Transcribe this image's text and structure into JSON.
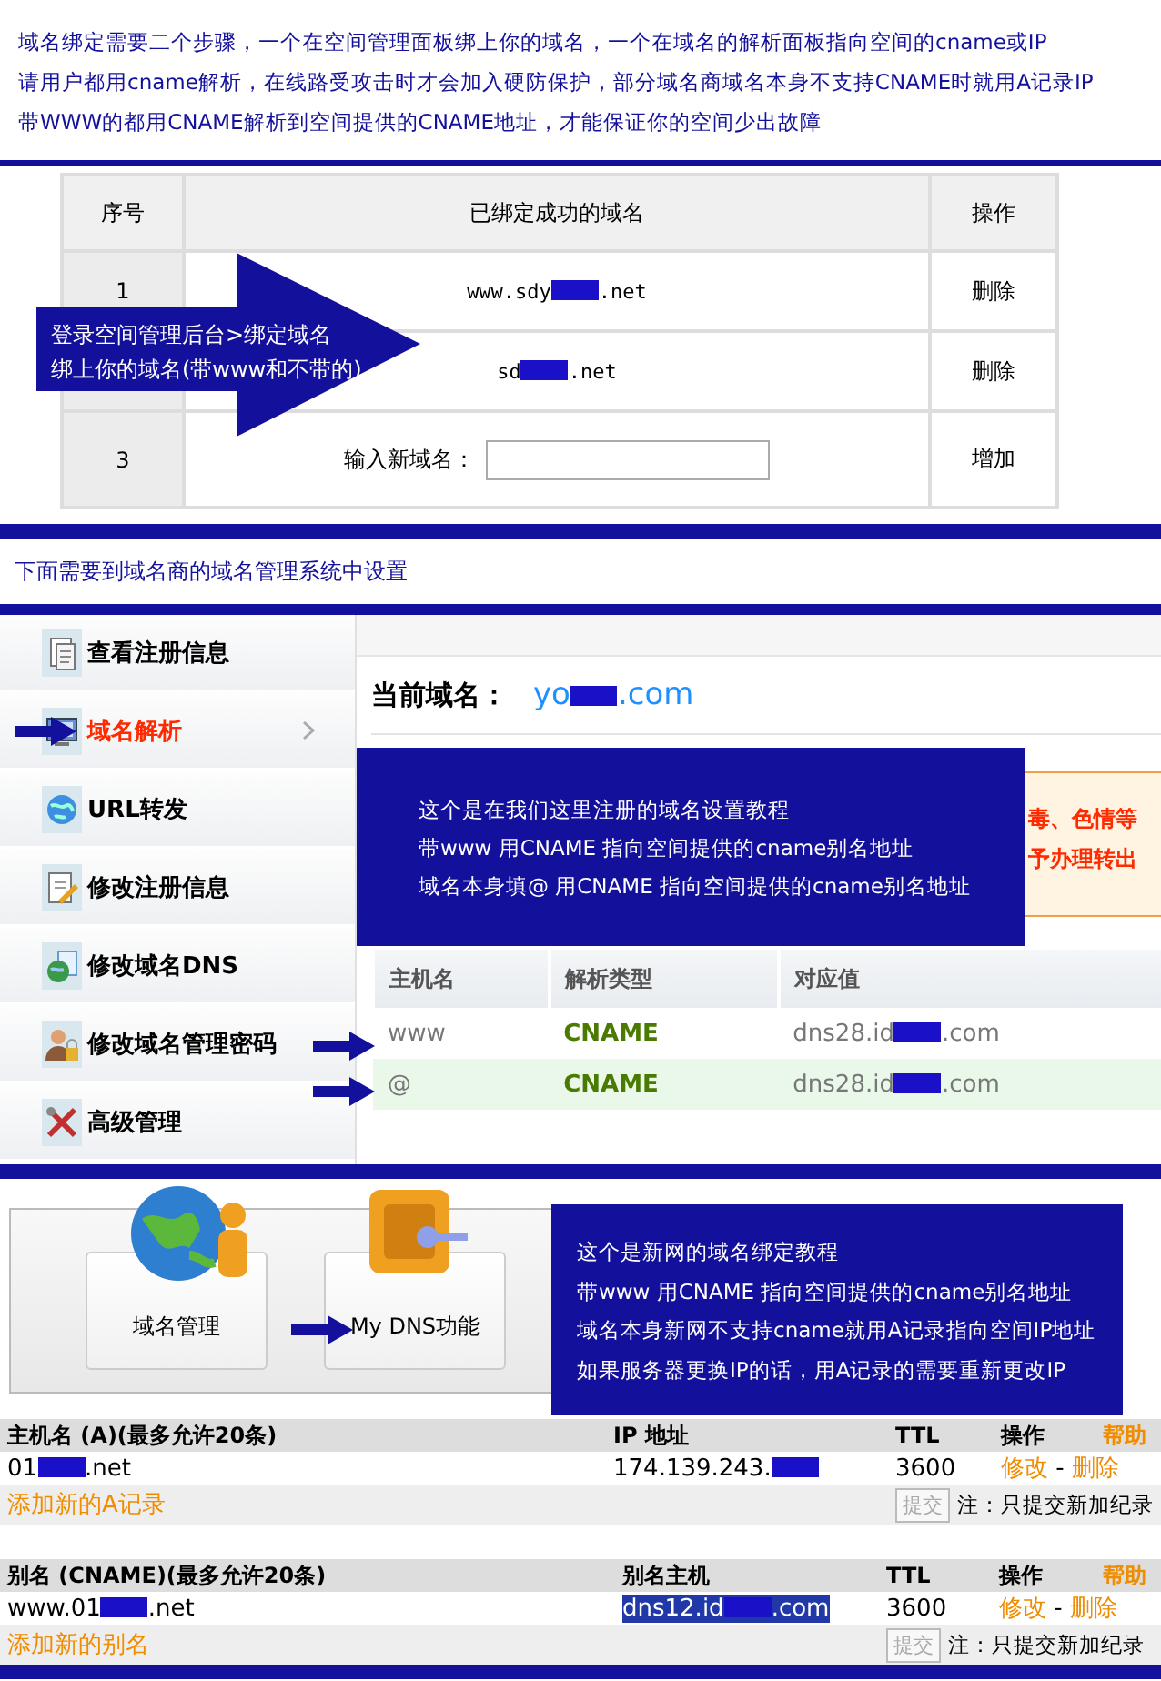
{
  "intro": {
    "lines": [
      "域名绑定需要二个步骤，一个在空间管理面板绑上你的域名，一个在域名的解析面板指向空间的cname或IP",
      "请用户都用cname解析，在线路受攻击时才会加入硬防保护，部分域名商域名本身不支持CNAME时就用A记录IP",
      "带WWW的都用CNAME解析到空间提供的CNAME地址，才能保证你的空间少出故障"
    ]
  },
  "binding_table": {
    "columns": [
      "序号",
      "已绑定成功的域名",
      "操作"
    ],
    "rows": [
      {
        "kind": "domain",
        "index": "1",
        "domain": {
          "prefix": "www.sdy",
          "suffix": ".net"
        },
        "action": "删除"
      },
      {
        "kind": "domain",
        "domain": {
          "prefix": "sd",
          "suffix": ".net"
        },
        "action": "删除"
      },
      {
        "kind": "input",
        "index": "3",
        "label": "输入新域名：",
        "action": "增加"
      }
    ]
  },
  "callout": {
    "lines": [
      "登录空间管理后台>绑定域名",
      "绑上你的域名(带www和不带的)"
    ]
  },
  "section_note": "下面需要到域名商的域名管理系统中设置",
  "registrar": {
    "sidebar": [
      {
        "label": "查看注册信息",
        "kind": "document",
        "selected": false
      },
      {
        "label": "域名解析",
        "kind": "monitor",
        "selected": true
      },
      {
        "label": "URL转发",
        "kind": "globe",
        "selected": false
      },
      {
        "label": "修改注册信息",
        "kind": "edit",
        "selected": false
      },
      {
        "label": "修改域名DNS",
        "kind": "globe-doc",
        "selected": false
      },
      {
        "label": "修改域名管理密码",
        "kind": "person-lock",
        "selected": false
      },
      {
        "label": "高级管理",
        "kind": "tools",
        "selected": false
      }
    ],
    "current_label": "当前域名：",
    "current_domain": {
      "prefix": "yo",
      "suffix": ".com"
    },
    "notice_lines": [
      "毒、色情等",
      "予办理转出"
    ],
    "overlay_lines": [
      "这个是在我们这里注册的域名设置教程",
      "带www 用CNAME 指向空间提供的cname别名地址",
      "域名本身填@ 用CNAME 指向空间提供的cname别名地址"
    ],
    "columns": [
      "主机名",
      "解析类型",
      "对应值"
    ],
    "rows": [
      {
        "host": "www",
        "type": "CNAME",
        "value": {
          "prefix": "dns28.id",
          "suffix": ".com"
        },
        "selected": false
      },
      {
        "host": "@",
        "type": "CNAME",
        "value": {
          "prefix": "dns28.id",
          "suffix": ".com"
        },
        "selected": true
      }
    ]
  },
  "xinnet": {
    "cards": [
      {
        "label": "域名管理",
        "kind": "globe-person"
      },
      {
        "label": "My DNS功能",
        "kind": "safe-key"
      }
    ],
    "overlay_lines": [
      "这个是新网的域名绑定教程",
      "带www 用CNAME 指向空间提供的cname别名地址",
      "域名本身新网不支持cname就用A记录指向空间IP地址",
      "如果服务器更换IP的话，用A记录的需要重新更改IP"
    ]
  },
  "record_tables": [
    {
      "columns": [
        "主机名 (A)(最多允许20条)",
        "IP 地址",
        "TTL",
        "操作"
      ],
      "help": "帮助",
      "row": {
        "host": {
          "prefix": "01",
          "suffix": ".net"
        },
        "value": {
          "prefix": "174.139.243."
        },
        "highlighted": false,
        "ttl": "3600",
        "edit": "修改",
        "separator": "-",
        "delete": "删除"
      },
      "add_link": "添加新的A记录",
      "submit": "提交",
      "note": "注：只提交新加纪录"
    },
    {
      "columns": [
        "别名 (CNAME)(最多允许20条)",
        "别名主机",
        "TTL",
        "操作"
      ],
      "help": "帮助",
      "row": {
        "host": {
          "prefix": "www.01",
          "suffix": ".net"
        },
        "value": {
          "prefix": "dns12.id",
          "suffix": ".com"
        },
        "highlighted": true,
        "ttl": "3600",
        "edit": "修改",
        "separator": "-",
        "delete": "删除"
      },
      "add_link": "添加新的别名",
      "submit": "提交",
      "note": "注：只提交新加纪录"
    }
  ]
}
